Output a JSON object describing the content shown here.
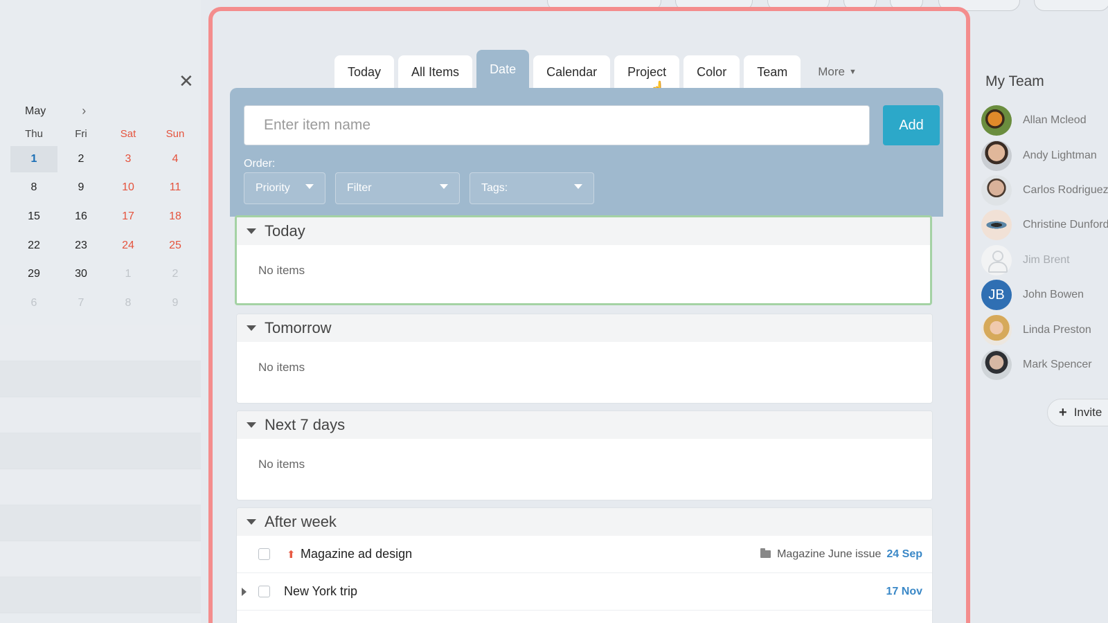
{
  "calendar": {
    "month": "May",
    "weekdays": [
      "Thu",
      "Fri",
      "Sat",
      "Sun"
    ],
    "weeks": [
      [
        "1",
        "2",
        "3",
        "4"
      ],
      [
        "8",
        "9",
        "10",
        "11"
      ],
      [
        "15",
        "16",
        "17",
        "18"
      ],
      [
        "22",
        "23",
        "24",
        "25"
      ],
      [
        "29",
        "30",
        "1",
        "2"
      ],
      [
        "6",
        "7",
        "8",
        "9"
      ]
    ]
  },
  "tabs": {
    "today": "Today",
    "all_items": "All Items",
    "date": "Date",
    "calendar": "Calendar",
    "project": "Project",
    "color": "Color",
    "team": "Team",
    "more": "More",
    "active": "Date"
  },
  "form": {
    "item_placeholder": "Enter item name",
    "item_value": "",
    "add_label": "Add",
    "order_label": "Order:",
    "priority": "Priority",
    "filter": "Filter",
    "tags": "Tags:"
  },
  "sections": {
    "today": {
      "title": "Today",
      "empty": "No items"
    },
    "tomorrow": {
      "title": "Tomorrow",
      "empty": "No items"
    },
    "next7": {
      "title": "Next 7 days",
      "empty": "No items"
    },
    "after_week": {
      "title": "After week",
      "items": [
        {
          "name": "Magazine ad design",
          "project": "Magazine June issue",
          "due": "24 Sep"
        },
        {
          "name": "New York trip",
          "project": "",
          "due": "17 Nov"
        }
      ]
    }
  },
  "team": {
    "title": "My Team",
    "members": [
      {
        "name": "Allan Mcleod"
      },
      {
        "name": "Andy Lightman"
      },
      {
        "name": "Carlos Rodriguez"
      },
      {
        "name": "Christine Dunford"
      },
      {
        "name": "Jim Brent"
      },
      {
        "name": "John Bowen",
        "initials": "JB"
      },
      {
        "name": "Linda Preston"
      },
      {
        "name": "Mark Spencer"
      }
    ],
    "invite_label": "Invite"
  },
  "colors": {
    "accent": "#2ca8c9",
    "panel": "#9fb9ce",
    "weekend": "#e5533d",
    "due": "#3a88c7",
    "frame_highlight": "#f48d8d",
    "selected_section": "#a4d2a4"
  }
}
